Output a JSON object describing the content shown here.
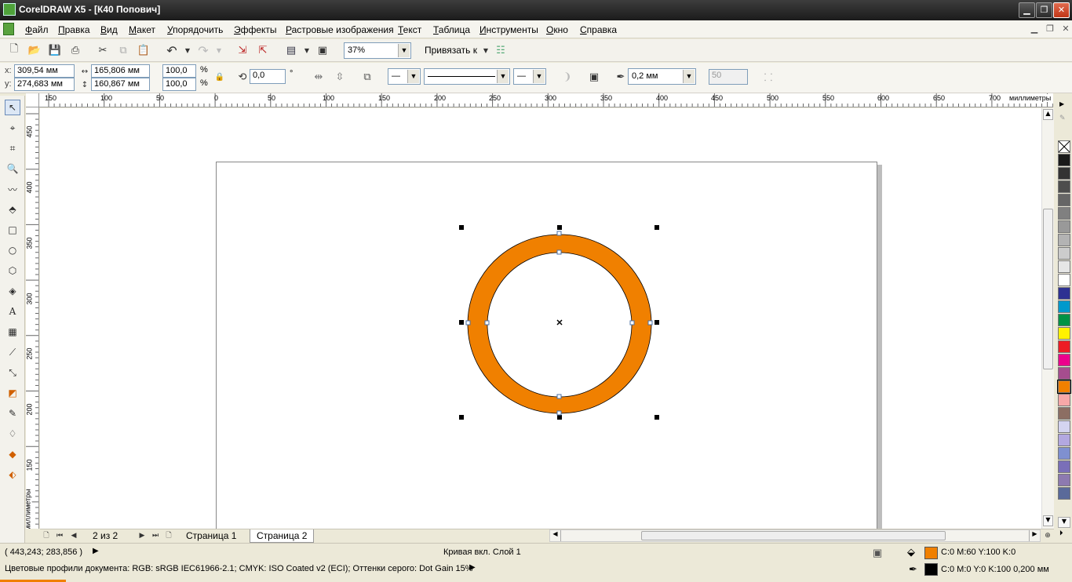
{
  "window": {
    "title": "CorelDRAW X5 - [К40 Попович]"
  },
  "menu": [
    "Файл",
    "Правка",
    "Вид",
    "Макет",
    "Упорядочить",
    "Эффекты",
    "Растровые изображения",
    "Текст",
    "Таблица",
    "Инструменты",
    "Окно",
    "Справка"
  ],
  "standard_toolbar": {
    "zoom": "37%",
    "snap_label": "Привязать к"
  },
  "property_bar": {
    "x": "309,54 мм",
    "y": "274,683 мм",
    "width": "165,806 мм",
    "height": "160,867 мм",
    "scale_x": "100,0",
    "scale_y": "100,0",
    "percent": "%",
    "rotation": "0,0",
    "degree": "°",
    "outline_width": "0,2 мм",
    "smoothing": "50"
  },
  "ruler": {
    "unit": "миллиметры",
    "h_ticks": [
      "150",
      "100",
      "50",
      "0",
      "50",
      "100",
      "150",
      "200",
      "250",
      "300",
      "350",
      "400",
      "450",
      "500",
      "550",
      "600",
      "650",
      "700"
    ],
    "v_ticks": [
      "450",
      "400",
      "350",
      "300",
      "250",
      "200",
      "150"
    ]
  },
  "pages": {
    "counter": "2 из 2",
    "tabs": [
      "Страница 1",
      "Страница 2"
    ],
    "active": 1
  },
  "status": {
    "cursor": "( 443,243; 283,856 )",
    "selection": "Кривая вкл. Слой 1",
    "profiles": "Цветовые профили документа: RGB: sRGB IEC61966-2.1; CMYK: ISO Coated v2 (ECI); Оттенки серого: Dot Gain 15%",
    "fill": "C:0 M:60 Y:100 K:0",
    "outline": "C:0 M:0 Y:0 K:100  0,200 мм",
    "fill_color": "#f08000",
    "outline_color": "#000000"
  },
  "palette": [
    "#1a1a1a",
    "#333333",
    "#4d4d4d",
    "#666666",
    "#808080",
    "#999999",
    "#b3b3b3",
    "#cccccc",
    "#e6e6e6",
    "#ffffff",
    "#2e3192",
    "#0099cc",
    "#009245",
    "#fff200",
    "#ed1c24",
    "#ec008c",
    "#a64d8e",
    "#f08000",
    "#f7a8a8",
    "#8c6e63",
    "#d4d4f0",
    "#b3a8e0",
    "#7f90d0",
    "#7a6fb8",
    "#8d7ab0",
    "#5a6a9a"
  ],
  "colors": {
    "object_fill": "#f08000",
    "accent": "#3a6ea5"
  }
}
